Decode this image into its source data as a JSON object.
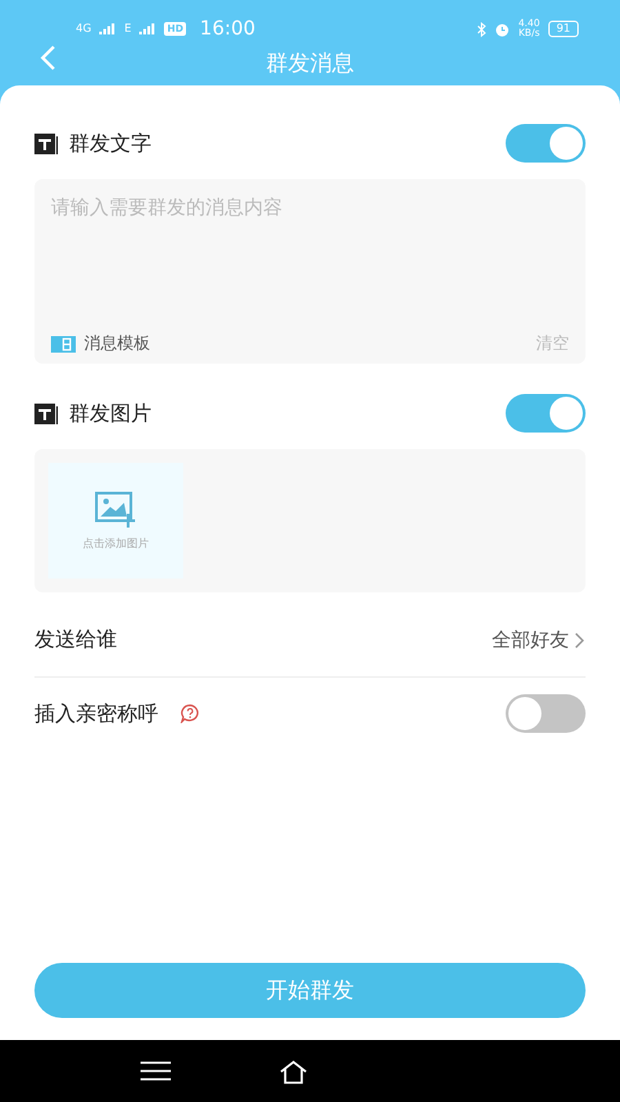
{
  "status_bar": {
    "network": [
      "4G",
      "E"
    ],
    "hd": "HD",
    "time": "16:00",
    "speed": "4.40",
    "speed_unit": "KB/s",
    "battery": "91"
  },
  "header": {
    "title": "群发消息"
  },
  "text_section": {
    "label": "群发文字",
    "on": true,
    "placeholder": "请输入需要群发的消息内容",
    "template_label": "消息模板",
    "clear_label": "清空"
  },
  "image_section": {
    "label": "群发图片",
    "on": true,
    "add_label": "点击添加图片"
  },
  "settings": [
    {
      "kind": "link",
      "label": "发送给谁",
      "value": "全部好友"
    },
    {
      "kind": "toggle",
      "label": "插入亲密称呼",
      "help": true,
      "on": false
    }
  ],
  "primary_button": "开始群发"
}
